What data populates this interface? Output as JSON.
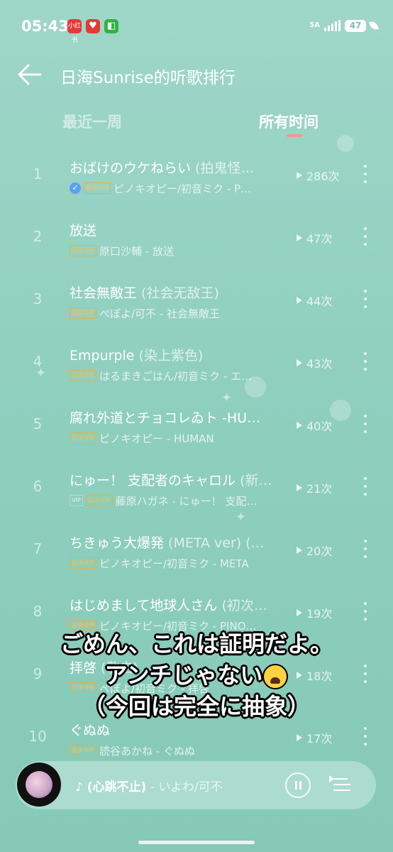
{
  "status_bar": {
    "time": "05:43",
    "badges": [
      {
        "label": "小红书",
        "color": "#e53935",
        "icon": "xiaohongshu-icon"
      },
      {
        "label": "♥",
        "color": "#e53935",
        "icon": "heart-app-icon"
      },
      {
        "label": "◧",
        "color": "#2fb344",
        "icon": "green-app-icon"
      }
    ],
    "network": "5A",
    "battery": "47"
  },
  "header": {
    "title": "日海Sunrise的听歌排行"
  },
  "tabs": [
    {
      "label": "最近一周",
      "active": false
    },
    {
      "label": "所有时间",
      "active": true
    }
  ],
  "songs": [
    {
      "rank": "1",
      "title": "おばけのウケねらい",
      "alias": " (拍鬼怪…",
      "verified": true,
      "tags": [
        "超清母带"
      ],
      "artist": "ピノキオピー/初音ミク - P…",
      "plays": "286次"
    },
    {
      "rank": "2",
      "title": "放送",
      "alias": "",
      "verified": false,
      "tags": [
        "超清母带"
      ],
      "artist": "原口沙輔 - 放送",
      "plays": "47次"
    },
    {
      "rank": "3",
      "title": "社会無敵王",
      "alias": " (社会无敌王)",
      "verified": false,
      "tags": [
        "超清母带"
      ],
      "artist": "ぺぽよ/可不 - 社会無敵王",
      "plays": "44次"
    },
    {
      "rank": "4",
      "title": "Empurple",
      "alias": " (染上紫色)",
      "verified": false,
      "tags": [
        "超清母带"
      ],
      "artist": "はるまきごはん/初音ミク - エ…",
      "plays": "43次"
    },
    {
      "rank": "5",
      "title": "腐れ外道とチョコレゐト -HU…",
      "alias": "",
      "verified": false,
      "tags": [
        "超清母带"
      ],
      "artist": "ピノキオピー - HUMAN",
      "plays": "40次"
    },
    {
      "rank": "6",
      "title": "にゅー！ 支配者のキャロル",
      "alias": " (新…",
      "verified": false,
      "tags": [
        "VIP",
        "超清母带"
      ],
      "artist": "藤原ハガネ - にゅー！ 支配…",
      "plays": "21次"
    },
    {
      "rank": "7",
      "title": "ちきゅう大爆発",
      "alias": " (META ver) (…",
      "verified": false,
      "tags": [
        "超清母带"
      ],
      "artist": "ピノキオピー/初音ミク - META",
      "plays": "20次"
    },
    {
      "rank": "8",
      "title": "はじめまして地球人さん",
      "alias": " (初次…",
      "verified": false,
      "tags": [
        "超清母带"
      ],
      "artist": "ピノキオピー/初音ミク - PINO…",
      "plays": "19次"
    },
    {
      "rank": "9",
      "title": "拝啓",
      "alias": " (敬启)",
      "verified": false,
      "tags": [
        "超清母带"
      ],
      "artist": "ぺぽよ/初音ミク - 拝啓",
      "plays": "18次"
    },
    {
      "rank": "10",
      "title": "ぐぬぬ",
      "alias": "",
      "verified": false,
      "tags": [
        "超清母带"
      ],
      "artist": "読谷あかね - ぐぬぬ",
      "plays": "17次"
    }
  ],
  "caption": {
    "line1": "ごめん、これは証明だよ。",
    "line2": "アンチじゃない",
    "line2_emoji": "crying-face-icon",
    "line3": "（今回は完全に抽象）"
  },
  "player": {
    "title": "♪ (心跳不止)",
    "artist": " - いよわ/可不"
  },
  "colors": {
    "background": "#8fcfbe",
    "tab_indicator": "#f19a8e",
    "tag_gold": "#f1c15a"
  }
}
